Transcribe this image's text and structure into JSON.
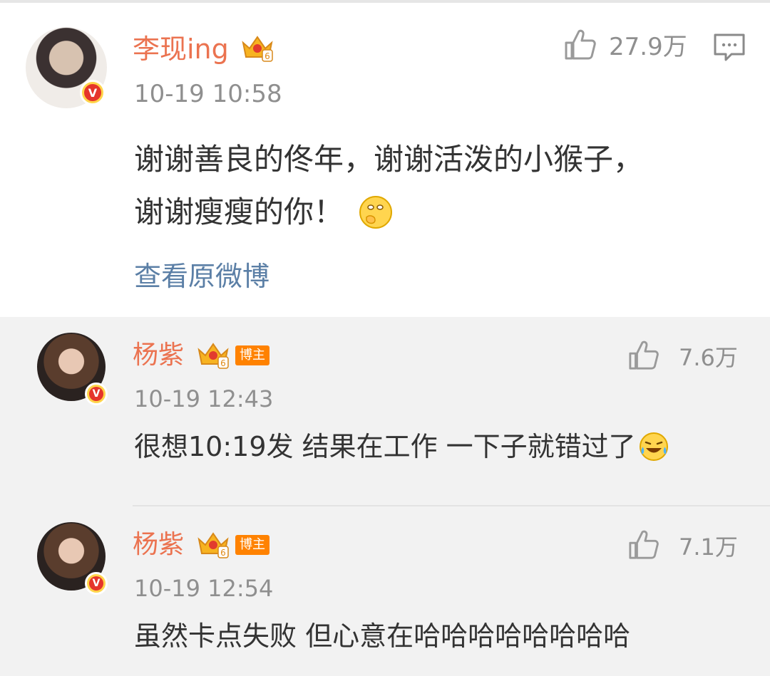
{
  "post": {
    "author": "李现ing",
    "time": "10-19 10:58",
    "likes": "27.9万",
    "content_line1": "谢谢善良的佟年，谢谢活泼的小猴子，",
    "content_line2": "谢谢瘦瘦的你！",
    "emoji": "thinking-face-icon",
    "view_original": "查看原微博"
  },
  "replies": [
    {
      "author": "杨紫",
      "badge": "博主",
      "time": "10-19 12:43",
      "likes": "7.6万",
      "content": "很想10:19发 结果在工作 一下子就错过了",
      "emoji": "laugh-cry-icon"
    },
    {
      "author": "杨紫",
      "badge": "博主",
      "time": "10-19 12:54",
      "likes": "7.1万",
      "content": "虽然卡点失败 但心意在哈哈哈哈哈哈哈哈"
    }
  ],
  "colors": {
    "username": "#eb7350",
    "link": "#5b7fa6",
    "meta": "#8f8f8f",
    "badge": "#ff8200"
  }
}
